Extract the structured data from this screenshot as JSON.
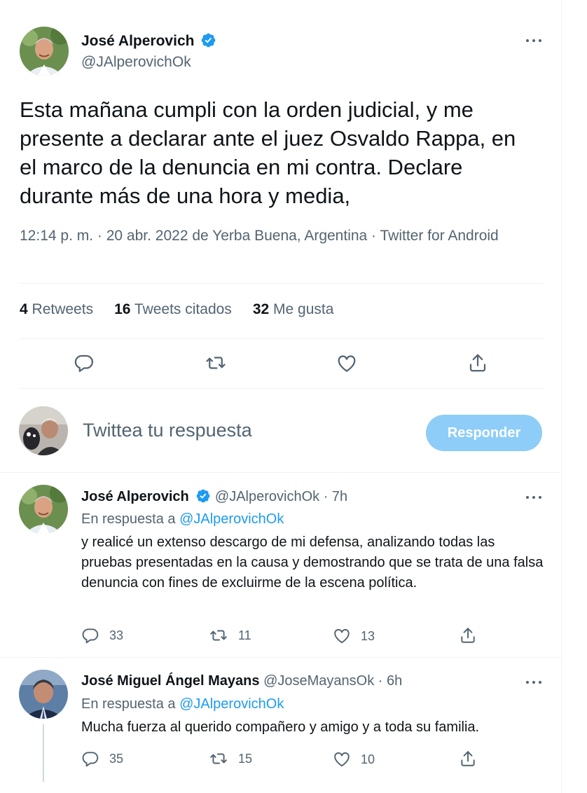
{
  "main_tweet": {
    "author_name": "José Alperovich",
    "author_handle": "@JAlperovichOk",
    "text": "Esta mañana cumpli con la orden judicial, y me presente a declarar ante el juez Osvaldo Rappa, en el marco de la denuncia en mi contra. Declare durante más de una hora y media,",
    "meta": "12:14 p. m. · 20 abr. 2022 de Yerba Buena, Argentina · Twitter for Android",
    "stats": [
      {
        "count": "4",
        "label": "Retweets"
      },
      {
        "count": "16",
        "label": "Tweets citados"
      },
      {
        "count": "32",
        "label": "Me gusta"
      }
    ]
  },
  "composer": {
    "prompt": "Twittea tu respuesta",
    "button_label": "Responder"
  },
  "replies": [
    {
      "author_name": "José Alperovich",
      "author_handle": "@JAlperovichOk",
      "time": "· 7h",
      "reply_to_prefix": "En respuesta a",
      "reply_to_handle": "@JAlperovichOk",
      "text": "y realicé un extenso descargo de mi defensa, analizando todas las pruebas presentadas en la causa y demostrando que se trata de una falsa denuncia con fines de excluirme de la escena política.",
      "reply_count": "33",
      "retweet_count": "11",
      "like_count": "13"
    },
    {
      "author_name": "José Miguel Ángel Mayans",
      "author_handle": "@JoseMayansOk",
      "time": "· 6h",
      "reply_to_prefix": "En respuesta a",
      "reply_to_handle": "@JAlperovichOk",
      "text": "Mucha fuerza al querido compañero y amigo y a toda su familia.",
      "reply_count": "35",
      "retweet_count": "15",
      "like_count": "10"
    }
  ],
  "colors": {
    "verified": "#1d9bf0",
    "accent": "#1d9bf0",
    "button_disabled": "#8ecdf8",
    "secondary_text": "#536471"
  }
}
